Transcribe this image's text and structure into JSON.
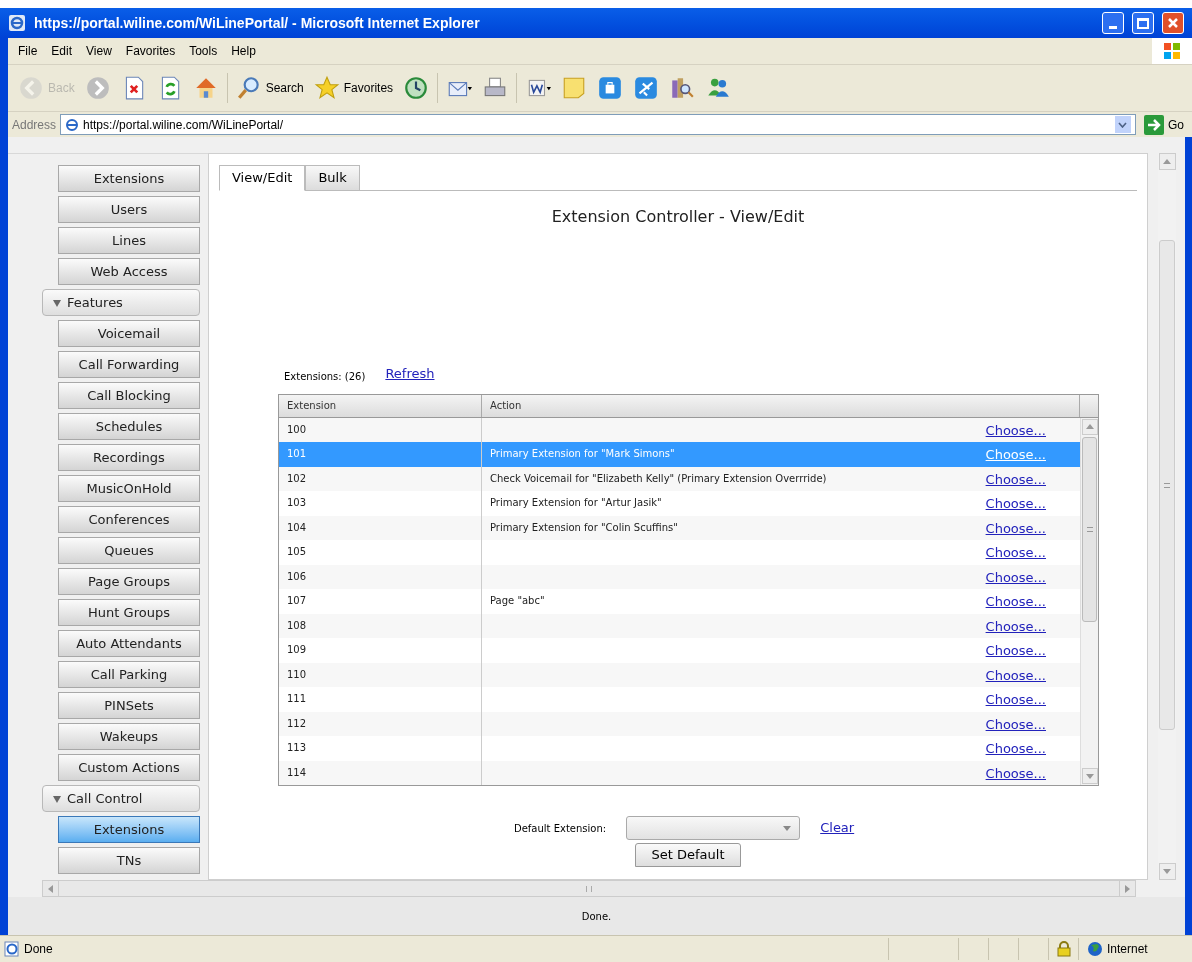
{
  "window": {
    "title": "https://portal.wiline.com/WiLinePortal/ - Microsoft Internet Explorer"
  },
  "menu": [
    "File",
    "Edit",
    "View",
    "Favorites",
    "Tools",
    "Help"
  ],
  "toolbar": [
    {
      "kind": "back",
      "label": "Back",
      "disabled": true
    },
    {
      "kind": "forward",
      "disabled": false
    },
    {
      "kind": "stop"
    },
    {
      "kind": "refresh"
    },
    {
      "kind": "home"
    },
    {
      "kind": "search",
      "label": "Search"
    },
    {
      "kind": "favorites",
      "label": "Favorites"
    },
    {
      "kind": "history"
    },
    {
      "kind": "mail"
    },
    {
      "kind": "print"
    },
    {
      "kind": "word"
    },
    {
      "kind": "note"
    },
    {
      "kind": "bag"
    },
    {
      "kind": "plane"
    },
    {
      "kind": "books"
    },
    {
      "kind": "messenger"
    }
  ],
  "address": {
    "label": "Address",
    "value": "https://portal.wiline.com/WiLinePortal/",
    "go": "Go"
  },
  "sidebar": {
    "items": [
      {
        "kind": "button",
        "label": "Extensions",
        "selected": false
      },
      {
        "kind": "button",
        "label": "Users",
        "selected": false
      },
      {
        "kind": "button",
        "label": "Lines",
        "selected": false
      },
      {
        "kind": "button",
        "label": "Web Access",
        "selected": false
      },
      {
        "kind": "group",
        "label": "Features",
        "expanded": true
      },
      {
        "kind": "button",
        "label": "Voicemail",
        "selected": false
      },
      {
        "kind": "button",
        "label": "Call Forwarding",
        "selected": false
      },
      {
        "kind": "button",
        "label": "Call Blocking",
        "selected": false
      },
      {
        "kind": "button",
        "label": "Schedules",
        "selected": false
      },
      {
        "kind": "button",
        "label": "Recordings",
        "selected": false
      },
      {
        "kind": "button",
        "label": "MusicOnHold",
        "selected": false
      },
      {
        "kind": "button",
        "label": "Conferences",
        "selected": false
      },
      {
        "kind": "button",
        "label": "Queues",
        "selected": false
      },
      {
        "kind": "button",
        "label": "Page Groups",
        "selected": false
      },
      {
        "kind": "button",
        "label": "Hunt Groups",
        "selected": false
      },
      {
        "kind": "button",
        "label": "Auto Attendants",
        "selected": false
      },
      {
        "kind": "button",
        "label": "Call Parking",
        "selected": false
      },
      {
        "kind": "button",
        "label": "PINSets",
        "selected": false
      },
      {
        "kind": "button",
        "label": "Wakeups",
        "selected": false
      },
      {
        "kind": "button",
        "label": "Custom Actions",
        "selected": false
      },
      {
        "kind": "group",
        "label": "Call Control",
        "expanded": true
      },
      {
        "kind": "button",
        "label": "Extensions",
        "selected": true
      },
      {
        "kind": "button",
        "label": "TNs",
        "selected": false
      }
    ]
  },
  "tabs": [
    {
      "label": "View/Edit",
      "selected": true
    },
    {
      "label": "Bulk",
      "selected": false
    }
  ],
  "page_title": "Extension Controller - View/Edit",
  "count_label": "Extensions: (26)",
  "refresh_link": "Refresh",
  "table": {
    "columns": [
      "Extension",
      "Action"
    ],
    "rows": [
      {
        "extension": "100",
        "action": "",
        "link": "Choose...",
        "selected": false
      },
      {
        "extension": "101",
        "action": "Primary Extension for \"Mark Simons\"",
        "link": "Choose...",
        "selected": true
      },
      {
        "extension": "102",
        "action": "Check Voicemail for \"Elizabeth Kelly\" (Primary Extension Overrride)",
        "link": "Choose...",
        "selected": false
      },
      {
        "extension": "103",
        "action": "Primary Extension for \"Artur Jasik\"",
        "link": "Choose...",
        "selected": false
      },
      {
        "extension": "104",
        "action": "Primary Extension for \"Colin Scuffins\"",
        "link": "Choose...",
        "selected": false
      },
      {
        "extension": "105",
        "action": "",
        "link": "Choose...",
        "selected": false
      },
      {
        "extension": "106",
        "action": "",
        "link": "Choose...",
        "selected": false
      },
      {
        "extension": "107",
        "action": "Page \"abc\"",
        "link": "Choose...",
        "selected": false
      },
      {
        "extension": "108",
        "action": "",
        "link": "Choose...",
        "selected": false
      },
      {
        "extension": "109",
        "action": "",
        "link": "Choose...",
        "selected": false
      },
      {
        "extension": "110",
        "action": "",
        "link": "Choose...",
        "selected": false
      },
      {
        "extension": "111",
        "action": "",
        "link": "Choose...",
        "selected": false
      },
      {
        "extension": "112",
        "action": "",
        "link": "Choose...",
        "selected": false
      },
      {
        "extension": "113",
        "action": "",
        "link": "Choose...",
        "selected": false
      },
      {
        "extension": "114",
        "action": "",
        "link": "Choose...",
        "selected": false
      }
    ]
  },
  "default_extension": {
    "label": "Default Extension:",
    "clear_link": "Clear",
    "button": "Set Default"
  },
  "frame_status": "Done.",
  "status_bar": {
    "text": "Done",
    "zone": "Internet"
  }
}
